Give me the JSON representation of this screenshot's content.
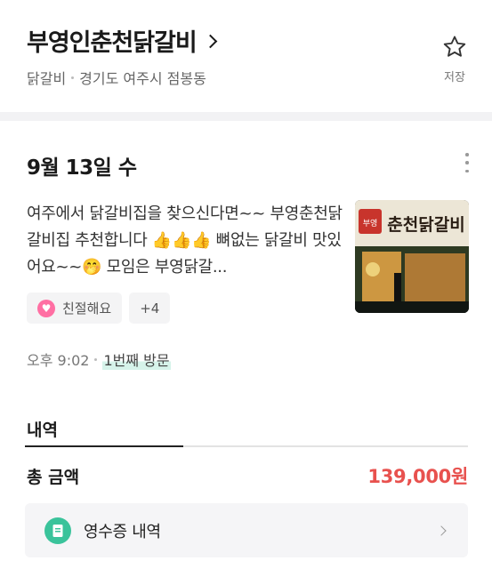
{
  "store": {
    "name": "부영인춘천닭갈비",
    "category": "닭갈비",
    "address": "경기도 여주시 점봉동",
    "save_label": "저장"
  },
  "visit": {
    "date": "9월 13일 수",
    "review": "여주에서 닭갈비집을 찾으신다면~~ 부영춘천닭갈비집 추천합니다 👍👍👍 뼈없는 닭갈비 맛있어요~~🤭 모임은 부영닭갈...",
    "tags": [
      {
        "icon": "heart-icon",
        "label": "친절해요"
      },
      {
        "label": "+4"
      }
    ],
    "time": "오후 9:02",
    "visit_count": "1번째 방문",
    "photo_sign_text": "부영 춘천닭갈비"
  },
  "history": {
    "section_title": "내역",
    "total_label": "총 금액",
    "total_amount": "139,000원",
    "receipt_label": "영수증 내역"
  },
  "colors": {
    "accent_red": "#e8514e",
    "accent_green": "#3ac39b",
    "heart_pink": "#ff6fa3"
  }
}
